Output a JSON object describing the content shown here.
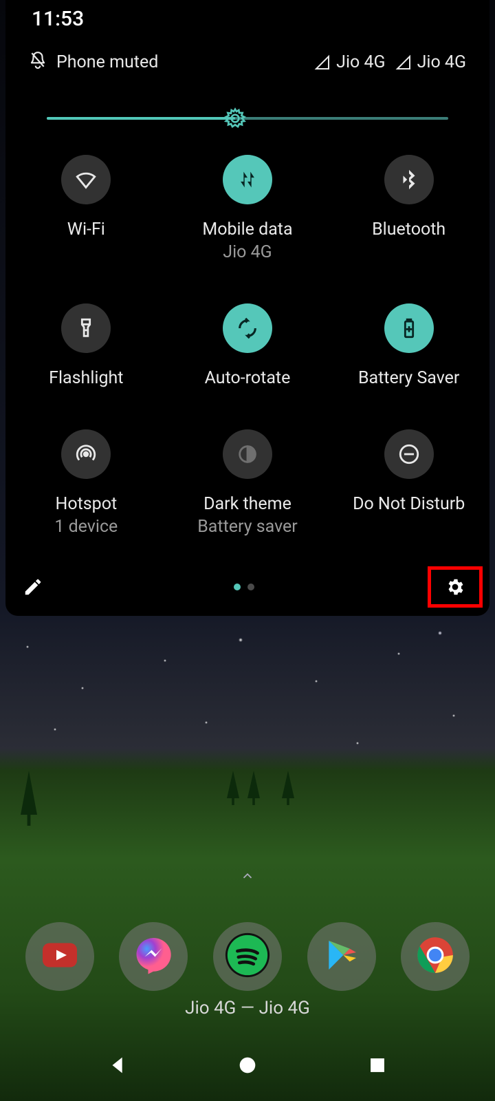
{
  "clock": "11:53",
  "status": {
    "muted_label": "Phone muted",
    "signal1": "Jio 4G",
    "signal2": "Jio 4G"
  },
  "brightness": {
    "percent": 47
  },
  "tiles": [
    {
      "id": "wifi",
      "label": "Wi-Fi",
      "sub": "",
      "state": "off"
    },
    {
      "id": "mobiledata",
      "label": "Mobile data",
      "sub": "Jio 4G",
      "state": "on"
    },
    {
      "id": "bluetooth",
      "label": "Bluetooth",
      "sub": "",
      "state": "off"
    },
    {
      "id": "flashlight",
      "label": "Flashlight",
      "sub": "",
      "state": "off"
    },
    {
      "id": "autorotate",
      "label": "Auto-rotate",
      "sub": "",
      "state": "on"
    },
    {
      "id": "batterysaver",
      "label": "Battery Saver",
      "sub": "",
      "state": "on"
    },
    {
      "id": "hotspot",
      "label": "Hotspot",
      "sub": "1 device",
      "state": "off"
    },
    {
      "id": "darktheme",
      "label": "Dark theme",
      "sub": "Battery saver",
      "state": "dim"
    },
    {
      "id": "dnd",
      "label": "Do Not Disturb",
      "sub": "",
      "state": "off"
    }
  ],
  "pager": {
    "count": 2,
    "active": 0
  },
  "carrier_line": "Jio 4G — Jio 4G",
  "dock": [
    "youtube",
    "messenger",
    "spotify",
    "playstore",
    "chrome"
  ]
}
